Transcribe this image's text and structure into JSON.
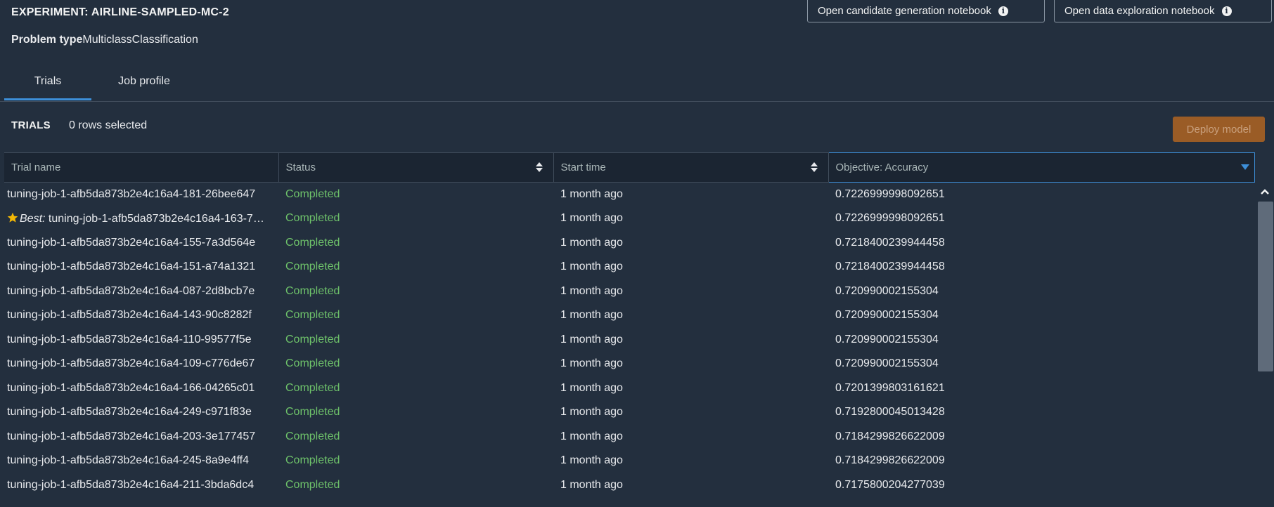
{
  "header": {
    "experiment_label": "EXPERIMENT: AIRLINE-SAMPLED-MC-2",
    "problem_type_label": "Problem type",
    "problem_type_value": "MulticlassClassification",
    "candidate_notebook_button": "Open candidate generation notebook",
    "exploration_notebook_button": "Open data exploration notebook"
  },
  "tabs": [
    {
      "label": "Trials",
      "active": true
    },
    {
      "label": "Job profile",
      "active": false
    }
  ],
  "trials": {
    "title": "TRIALS",
    "rows_selected": "0 rows selected",
    "deploy_button": "Deploy model"
  },
  "table": {
    "columns": [
      "Trial name",
      "Status",
      "Start time",
      "Objective: Accuracy"
    ],
    "best_label": "Best:",
    "rows": [
      {
        "name": "tuning-job-1-afb5da873b2e4c16a4-181-26bee647",
        "status": "Completed",
        "start": "1 month ago",
        "objective": "0.7226999998092651",
        "best": false
      },
      {
        "name": "tuning-job-1-afb5da873b2e4c16a4-163-7…",
        "status": "Completed",
        "start": "1 month ago",
        "objective": "0.7226999998092651",
        "best": true
      },
      {
        "name": "tuning-job-1-afb5da873b2e4c16a4-155-7a3d564e",
        "status": "Completed",
        "start": "1 month ago",
        "objective": "0.7218400239944458",
        "best": false
      },
      {
        "name": "tuning-job-1-afb5da873b2e4c16a4-151-a74a1321",
        "status": "Completed",
        "start": "1 month ago",
        "objective": "0.7218400239944458",
        "best": false
      },
      {
        "name": "tuning-job-1-afb5da873b2e4c16a4-087-2d8bcb7e",
        "status": "Completed",
        "start": "1 month ago",
        "objective": "0.720990002155304",
        "best": false
      },
      {
        "name": "tuning-job-1-afb5da873b2e4c16a4-143-90c8282f",
        "status": "Completed",
        "start": "1 month ago",
        "objective": "0.720990002155304",
        "best": false
      },
      {
        "name": "tuning-job-1-afb5da873b2e4c16a4-110-99577f5e",
        "status": "Completed",
        "start": "1 month ago",
        "objective": "0.720990002155304",
        "best": false
      },
      {
        "name": "tuning-job-1-afb5da873b2e4c16a4-109-c776de67",
        "status": "Completed",
        "start": "1 month ago",
        "objective": "0.720990002155304",
        "best": false
      },
      {
        "name": "tuning-job-1-afb5da873b2e4c16a4-166-04265c01",
        "status": "Completed",
        "start": "1 month ago",
        "objective": "0.7201399803161621",
        "best": false
      },
      {
        "name": "tuning-job-1-afb5da873b2e4c16a4-249-c971f83e",
        "status": "Completed",
        "start": "1 month ago",
        "objective": "0.7192800045013428",
        "best": false
      },
      {
        "name": "tuning-job-1-afb5da873b2e4c16a4-203-3e177457",
        "status": "Completed",
        "start": "1 month ago",
        "objective": "0.7184299826622009",
        "best": false
      },
      {
        "name": "tuning-job-1-afb5da873b2e4c16a4-245-8a9e4ff4",
        "status": "Completed",
        "start": "1 month ago",
        "objective": "0.7184299826622009",
        "best": false
      },
      {
        "name": "tuning-job-1-afb5da873b2e4c16a4-211-3bda6dc4",
        "status": "Completed",
        "start": "1 month ago",
        "objective": "0.7175800204277039",
        "best": false
      }
    ]
  },
  "colors": {
    "background": "#232f3e",
    "header_row": "#1b2532",
    "status_completed": "#6ec26a",
    "accent_blue": "#3d8fd8",
    "deploy_disabled": "#9a5c26",
    "star": "#f2b705"
  },
  "icons": {
    "info": "info-icon",
    "sort": "sort-icon",
    "sort_active": "sort-descending-icon",
    "best": "star-icon",
    "scroll_up": "chevron-up-icon"
  }
}
